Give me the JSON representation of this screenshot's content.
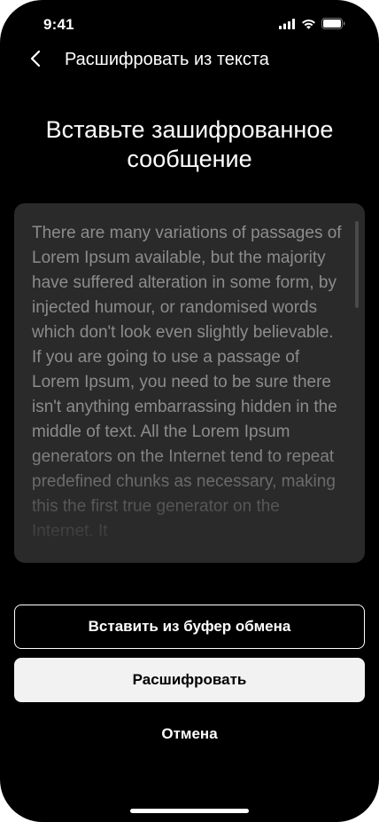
{
  "status_bar": {
    "time": "9:41",
    "icons": [
      "cellular-signal-icon",
      "wifi-icon",
      "battery-icon"
    ]
  },
  "nav": {
    "back_icon": "chevron-left-icon",
    "title": "Расшифровать из текста"
  },
  "heading": "Вставьте зашифрованное сообщение",
  "text_input": {
    "value": "There are many variations of passages of Lorem Ipsum available, but the majority have suffered alteration in some form, by injected humour, or randomised words which don't look even slightly believable. If you are going to use a passage of Lorem Ipsum, you need to be sure there isn't anything embarrassing hidden in the middle of text. All the Lorem Ipsum generators on the Internet tend to repeat predefined chunks as necessary, making this the first true generator on the Internet. It"
  },
  "buttons": {
    "paste_label": "Вставить из буфер обмена",
    "decrypt_label": "Расшифровать",
    "cancel_label": "Отмена"
  },
  "colors": {
    "background": "#000000",
    "text_area_bg": "#2a2a2a",
    "text_area_text": "#8c8c8c",
    "primary_button_bg": "#f2f2f2"
  }
}
